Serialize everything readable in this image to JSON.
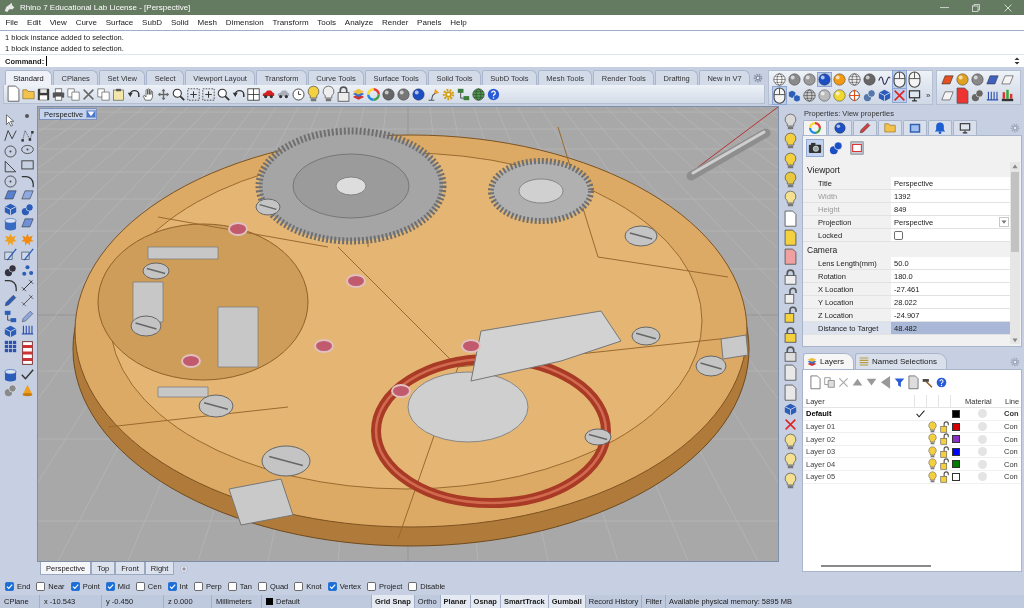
{
  "window": {
    "title": "Rhino 7 Educational Lab License - [Perspective]"
  },
  "menu": [
    "File",
    "Edit",
    "View",
    "Curve",
    "Surface",
    "SubD",
    "Solid",
    "Mesh",
    "Dimension",
    "Transform",
    "Tools",
    "Analyze",
    "Render",
    "Panels",
    "Help"
  ],
  "command_history": [
    "1 block instance added to selection.",
    "1 block instance added to selection."
  ],
  "command": {
    "label": "Command:"
  },
  "toolbar_tabs": [
    {
      "label": "Standard",
      "selected": true
    },
    {
      "label": "CPlanes",
      "selected": false
    },
    {
      "label": "Set View",
      "selected": false
    },
    {
      "label": "Select",
      "selected": false
    },
    {
      "label": "Viewport Layout",
      "selected": false
    },
    {
      "label": "Transform",
      "selected": false
    },
    {
      "label": "Curve Tools",
      "selected": false
    },
    {
      "label": "Surface Tools",
      "selected": false
    },
    {
      "label": "Solid Tools",
      "selected": false
    },
    {
      "label": "SubD Tools",
      "selected": false
    },
    {
      "label": "Mesh Tools",
      "selected": false
    },
    {
      "label": "Render Tools",
      "selected": false
    },
    {
      "label": "Drafting",
      "selected": false
    },
    {
      "label": "New in V7",
      "selected": false
    }
  ],
  "display_toolbar": {
    "buttons": [
      {
        "selected": false
      },
      {
        "selected": false
      },
      {
        "selected": false
      },
      {
        "selected": true
      },
      {
        "selected": false
      },
      {
        "selected": false
      },
      {
        "selected": false
      },
      {
        "selected": false
      },
      {
        "selected": true
      },
      {
        "selected": false
      },
      {
        "selected": true
      },
      {
        "selected": false
      },
      {
        "selected": false
      },
      {
        "selected": false
      },
      {
        "selected": false
      },
      {
        "selected": false
      },
      {
        "selected": false
      },
      {
        "selected": false
      },
      {
        "selected": true
      },
      {
        "selected": false
      }
    ],
    "overflow": "»"
  },
  "viewport": {
    "title": "Perspective"
  },
  "viewport_tabs": [
    {
      "label": "Perspective",
      "selected": true
    },
    {
      "label": "Top",
      "selected": false
    },
    {
      "label": "Front",
      "selected": false
    },
    {
      "label": "Right",
      "selected": false
    }
  ],
  "properties": {
    "title": "Properties: View properties",
    "tabs": [
      {
        "selected": true
      },
      {
        "selected": false
      },
      {
        "selected": false
      },
      {
        "selected": false
      },
      {
        "selected": false
      },
      {
        "selected": false
      },
      {
        "selected": false
      }
    ],
    "view_tabs": [
      {
        "selected": true
      },
      {
        "selected": false
      },
      {
        "selected": false
      }
    ],
    "sections": [
      {
        "heading": "Viewport",
        "rows": [
          {
            "kind": "text",
            "label": "Title",
            "value": "Perspective",
            "disabled": false,
            "selected": false
          },
          {
            "kind": "text",
            "label": "Width",
            "value": "1392",
            "disabled": true,
            "selected": false
          },
          {
            "kind": "text",
            "label": "Height",
            "value": "849",
            "disabled": true,
            "selected": false
          },
          {
            "kind": "dropdown",
            "label": "Projection",
            "value": "Perspective",
            "disabled": false,
            "selected": false
          },
          {
            "kind": "checkbox",
            "label": "Locked",
            "checked": false,
            "disabled": false,
            "selected": false
          }
        ]
      },
      {
        "heading": "Camera",
        "rows": [
          {
            "kind": "text",
            "label": "Lens Length(mm)",
            "value": "50.0",
            "disabled": false,
            "selected": false
          },
          {
            "kind": "text",
            "label": "Rotation",
            "value": "180.0",
            "disabled": false,
            "selected": false
          },
          {
            "kind": "text",
            "label": "X Location",
            "value": "-27.461",
            "disabled": false,
            "selected": false
          },
          {
            "kind": "text",
            "label": "Y Location",
            "value": "28.022",
            "disabled": false,
            "selected": false
          },
          {
            "kind": "text",
            "label": "Z Location",
            "value": "-24.907",
            "disabled": false,
            "selected": false
          },
          {
            "kind": "text",
            "label": "Distance to Target",
            "value": "48.482",
            "disabled": false,
            "selected": true
          }
        ]
      }
    ]
  },
  "layers": {
    "tabs": [
      {
        "label": "Layers",
        "selected": true
      },
      {
        "label": "Named Selections",
        "selected": false
      }
    ],
    "columns": [
      "Layer",
      "Material",
      "Line"
    ],
    "rows": [
      {
        "name": "Default",
        "current": true,
        "color": "#000000",
        "linetype": "Con"
      },
      {
        "name": "Layer 01",
        "current": false,
        "visible": true,
        "locked": false,
        "color": "#d40000",
        "linetype": "Con"
      },
      {
        "name": "Layer 02",
        "current": false,
        "visible": true,
        "locked": false,
        "color": "#8b2fc9",
        "linetype": "Con"
      },
      {
        "name": "Layer 03",
        "current": false,
        "visible": true,
        "locked": false,
        "color": "#0000ff",
        "linetype": "Con"
      },
      {
        "name": "Layer 04",
        "current": false,
        "visible": true,
        "locked": false,
        "color": "#007a00",
        "linetype": "Con"
      },
      {
        "name": "Layer 05",
        "current": false,
        "visible": true,
        "locked": false,
        "color": "#ffffff",
        "linetype": "Con"
      }
    ]
  },
  "osnaps": [
    {
      "label": "End",
      "checked": true
    },
    {
      "label": "Near",
      "checked": false
    },
    {
      "label": "Point",
      "checked": true
    },
    {
      "label": "Mid",
      "checked": true
    },
    {
      "label": "Cen",
      "checked": false
    },
    {
      "label": "Int",
      "checked": true
    },
    {
      "label": "Perp",
      "checked": false
    },
    {
      "label": "Tan",
      "checked": false
    },
    {
      "label": "Quad",
      "checked": false
    },
    {
      "label": "Knot",
      "checked": false
    },
    {
      "label": "Vertex",
      "checked": true
    },
    {
      "label": "Project",
      "checked": false
    },
    {
      "label": "Disable",
      "checked": false
    }
  ],
  "status_bar": {
    "cplane": "CPlane",
    "x": "x -10.543",
    "y": "y -0.450",
    "z": "z 0.000",
    "units": "Millimeters",
    "layer": {
      "name": "Default",
      "color": "#000000"
    },
    "toggles": [
      {
        "label": "Grid Snap",
        "on": true
      },
      {
        "label": "Ortho",
        "on": false
      },
      {
        "label": "Planar",
        "on": true
      },
      {
        "label": "Osnap",
        "on": true
      },
      {
        "label": "SmartTrack",
        "on": true
      },
      {
        "label": "Gumball",
        "on": true
      },
      {
        "label": "Record History",
        "on": false
      },
      {
        "label": "Filter",
        "on": false
      }
    ],
    "memory": "Available physical memory: 5895 MB"
  }
}
